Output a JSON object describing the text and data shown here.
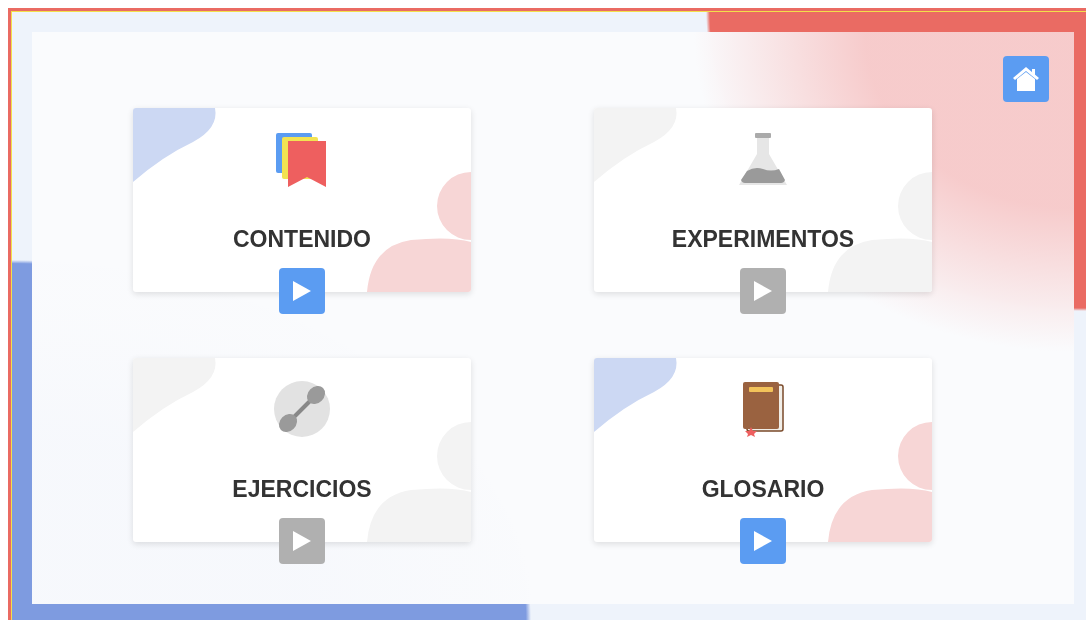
{
  "cards": [
    {
      "kind": "bookmarks",
      "title": "CONTENIDO",
      "disabled": false
    },
    {
      "kind": "flask",
      "title": "EXPERIMENTOS",
      "disabled": true
    },
    {
      "kind": "dumbbell",
      "title": "EJERCICIOS",
      "disabled": true
    },
    {
      "kind": "book",
      "title": "GLOSARIO",
      "disabled": false
    }
  ]
}
